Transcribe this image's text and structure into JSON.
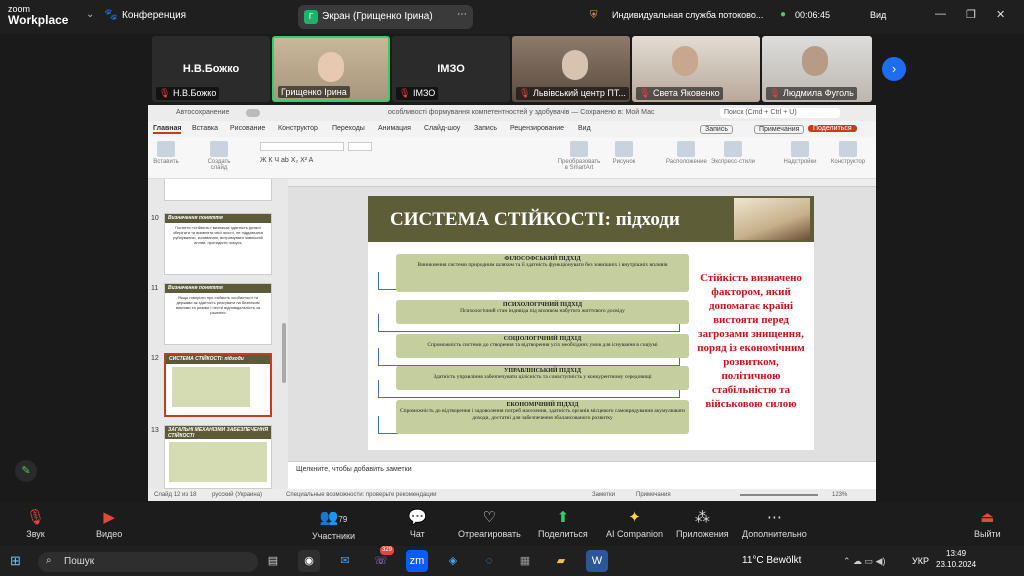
{
  "zoom": {
    "logo_top": "zoom",
    "logo_bottom": "Workplace",
    "conference": "Конференция",
    "screen_share": "Экран (Грищенко Ірина)",
    "screen_icon": "Г",
    "service": "Индивидуальная служба потоково...",
    "timer": "00:06:45",
    "view": "Вид"
  },
  "participants": [
    {
      "display": "Н.В.Божко",
      "label": "Н.В.Божко"
    },
    {
      "display": "",
      "label": "Грищенко Ірина"
    },
    {
      "display": "ІМЗО",
      "label": "ІМЗО"
    },
    {
      "display": "",
      "label": "Львівський центр ПТ..."
    },
    {
      "display": "",
      "label": "Света Яковенко"
    },
    {
      "display": "",
      "label": "Людмила Фуголь"
    }
  ],
  "ppt": {
    "title": "особливості формування компетентностей у здобувачів — Сохранено в: Мой Мас",
    "autosave": "Автосохранение",
    "search": "Поиск (Cmd + Ctrl + U)",
    "tabs": [
      "Главная",
      "Вставка",
      "Рисование",
      "Конструктор",
      "Переходы",
      "Анимация",
      "Слайд-шоу",
      "Запись",
      "Рецензирование",
      "Вид"
    ],
    "record": "Запись",
    "comments": "Примечания",
    "share": "Поделиться",
    "ribbon": [
      "Вставить",
      "Создать слайд",
      "Преобразовать в SmartArt",
      "Рисунок",
      "Расположение",
      "Экспресс-стили",
      "Надстройки",
      "Конструктор"
    ],
    "thumbs": [
      {
        "n": "10",
        "head": "Визначення поняття",
        "text": "Поняття «стійкість» визначає здатність деякої зберігати та виявляти свої якості, не піддаючися руйнуванню, коливанню, витримувати зовнішній вплив, протидіяти чомусь"
      },
      {
        "n": "11",
        "head": "Визначення поняття",
        "text": "Якщо говорити про стійкість особистості та держави як здатність реагувати на безпекові виклики та ризики і нести відповідальність за рішення"
      },
      {
        "n": "12",
        "head": "СИСТЕМА СТІЙКОСТІ: підходи",
        "text": ""
      },
      {
        "n": "13",
        "head": "ЗАГАЛЬНІ МЕХАНІЗМИ ЗАБЕЗПЕЧЕННЯ СТІЙКОСТІ",
        "text": ""
      }
    ],
    "slide_title": "СИСТЕМА СТІЙКОСТІ: підходи",
    "boxes": [
      {
        "h": "ФІЛОСОФСЬКИЙ ПІДХІД",
        "d": "Виникнення системи природним шляхом та її здатність функціонувати без зовнішніх і внутрішніх впливів"
      },
      {
        "h": "ПСИХОЛОГІЧНИЙ ПІДХІД",
        "d": "Психологічний стан індивіда під впливом набутого життєвого досвіду"
      },
      {
        "h": "СОЦІОЛОГІЧНИЙ ПІДХІД",
        "d": "Спроможність системи до створення та відтворення усіх необхідних умов для існування в соціумі"
      },
      {
        "h": "УПРАВЛІНСЬКИЙ ПІДХІД",
        "d": "Здатність управління забезпечувати цілісність та сонаступність у конкурентному середовищі"
      },
      {
        "h": "ЕКОНОМІЧНИЙ ПІДХІД",
        "d": "Спроможність до відтворення і задоволення потреб населення, здатність органів місцевого самоврядування акумулювати доходи, достатні для забезпечення збалансованого розвитку"
      }
    ],
    "note": "Стійкість визначено фактором, який допомагає країні вистояти перед загрозами знищення, поряд із економічним розвитком, політичною стабільністю та військовою силою",
    "notes_placeholder": "Щелкните, чтобы добавить заметки",
    "status": {
      "slide": "Слайд 12 из 18",
      "lang": "русский (Украина)",
      "access": "Специальные возможности: проверьте рекомендации",
      "notes": "Заметки",
      "comments": "Примечания",
      "zoom": "123%"
    }
  },
  "toolbar": [
    "Звук",
    "Видео",
    "Участники",
    "Чат",
    "Отреагировать",
    "Поделиться",
    "AI Companion",
    "Приложения",
    "Дополнительно"
  ],
  "participants_count": "79",
  "taskbar": {
    "search": "Пошук",
    "weather": "11°C  Bewölkt",
    "lang": "УКР",
    "time": "13:49",
    "date": "23.10.2024",
    "badge": "329"
  }
}
